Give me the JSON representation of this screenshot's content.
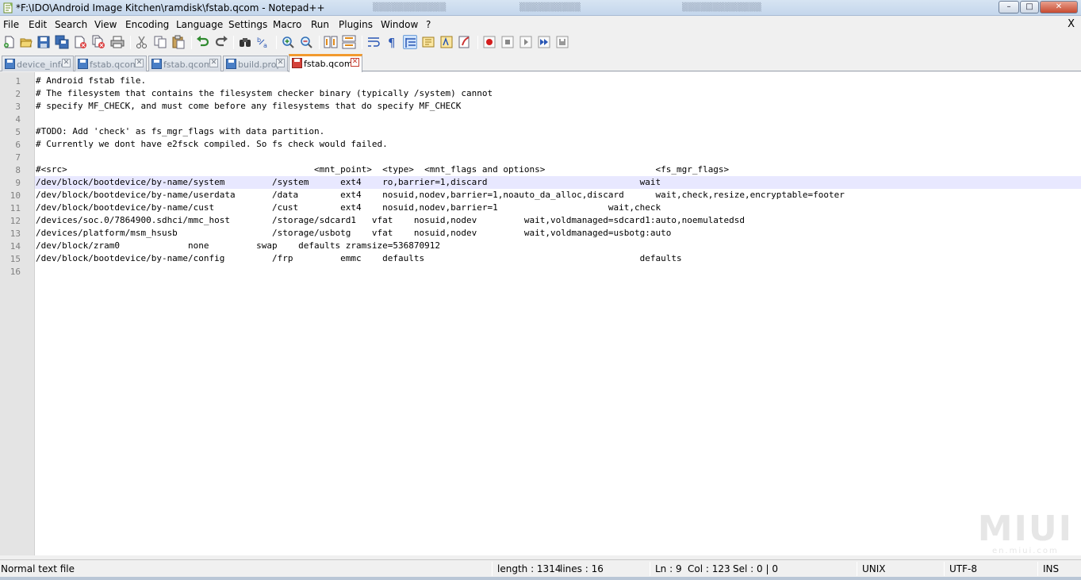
{
  "window": {
    "title": "*F:\\IDO\\Android Image Kitchen\\ramdisk\\fstab.qcom - Notepad++",
    "minimize": "–",
    "maximize": "□",
    "close": "✕"
  },
  "menu": {
    "items": [
      "File",
      "Edit",
      "Search",
      "View",
      "Encoding",
      "Language",
      "Settings",
      "Macro",
      "Run",
      "Plugins",
      "Window",
      "?"
    ],
    "close": "X"
  },
  "toolbar": {
    "icons": [
      "new-file-icon",
      "open-file-icon",
      "save-icon",
      "save-all-icon",
      "close-file-icon",
      "close-all-icon",
      "print-icon",
      "cut-icon",
      "copy-icon",
      "paste-icon",
      "undo-icon",
      "redo-icon",
      "find-icon",
      "replace-icon",
      "zoom-in-icon",
      "zoom-out-icon",
      "sync-vertical-icon",
      "sync-horizontal-icon",
      "word-wrap-icon",
      "show-all-chars-icon",
      "indent-guide-icon",
      "doc-map-icon",
      "function-list-icon",
      "folder-workspace-icon",
      "monitoring-icon",
      "record-macro-icon",
      "stop-macro-icon",
      "play-macro-icon",
      "run-macro-multiple-icon",
      "save-macro-icon"
    ]
  },
  "tabs": [
    {
      "label": "device_info",
      "active": false,
      "modified": false
    },
    {
      "label": "fstab.qcom",
      "active": false,
      "modified": false
    },
    {
      "label": "fstab.qcom",
      "active": false,
      "modified": false
    },
    {
      "label": "build.prop",
      "active": false,
      "modified": false
    },
    {
      "label": "fstab.qcom",
      "active": true,
      "modified": true
    }
  ],
  "tab_close": "✕",
  "editor": {
    "current_line": 9,
    "lines": [
      "# Android fstab file.",
      "# The filesystem that contains the filesystem checker binary (typically /system) cannot",
      "# specify MF_CHECK, and must come before any filesystems that do specify MF_CHECK",
      "",
      "#TODO: Add 'check' as fs_mgr_flags with data partition.",
      "# Currently we dont have e2fsck compiled. So fs check would failed.",
      "",
      "#<src>                                               <mnt_point>  <type>  <mnt_flags and options>                     <fs_mgr_flags>",
      "/dev/block/bootdevice/by-name/system         /system      ext4    ro,barrier=1,discard                             wait",
      "/dev/block/bootdevice/by-name/userdata       /data        ext4    nosuid,nodev,barrier=1,noauto_da_alloc,discard      wait,check,resize,encryptable=footer",
      "/dev/block/bootdevice/by-name/cust           /cust        ext4    nosuid,nodev,barrier=1                     wait,check",
      "/devices/soc.0/7864900.sdhci/mmc_host        /storage/sdcard1   vfat    nosuid,nodev         wait,voldmanaged=sdcard1:auto,noemulatedsd",
      "/devices/platform/msm_hsusb                  /storage/usbotg    vfat    nosuid,nodev         wait,voldmanaged=usbotg:auto",
      "/dev/block/zram0             none         swap    defaults zramsize=536870912",
      "/dev/block/bootdevice/by-name/config         /frp         emmc    defaults                                         defaults",
      ""
    ]
  },
  "status": {
    "file_type": "Normal text file",
    "length": "length : 1314",
    "lines": "lines : 16",
    "ln": "Ln : 9",
    "col": "Col : 123",
    "sel": "Sel : 0 | 0",
    "eol": "UNIX",
    "encoding": "UTF-8",
    "mode": "INS"
  },
  "watermark": {
    "big": "MIUI",
    "small": "en.miui.com"
  },
  "colors": {
    "active_tab_accent": "#f29a2e",
    "current_line": "#e8e8ff",
    "gutter": "#e4e4e4"
  }
}
